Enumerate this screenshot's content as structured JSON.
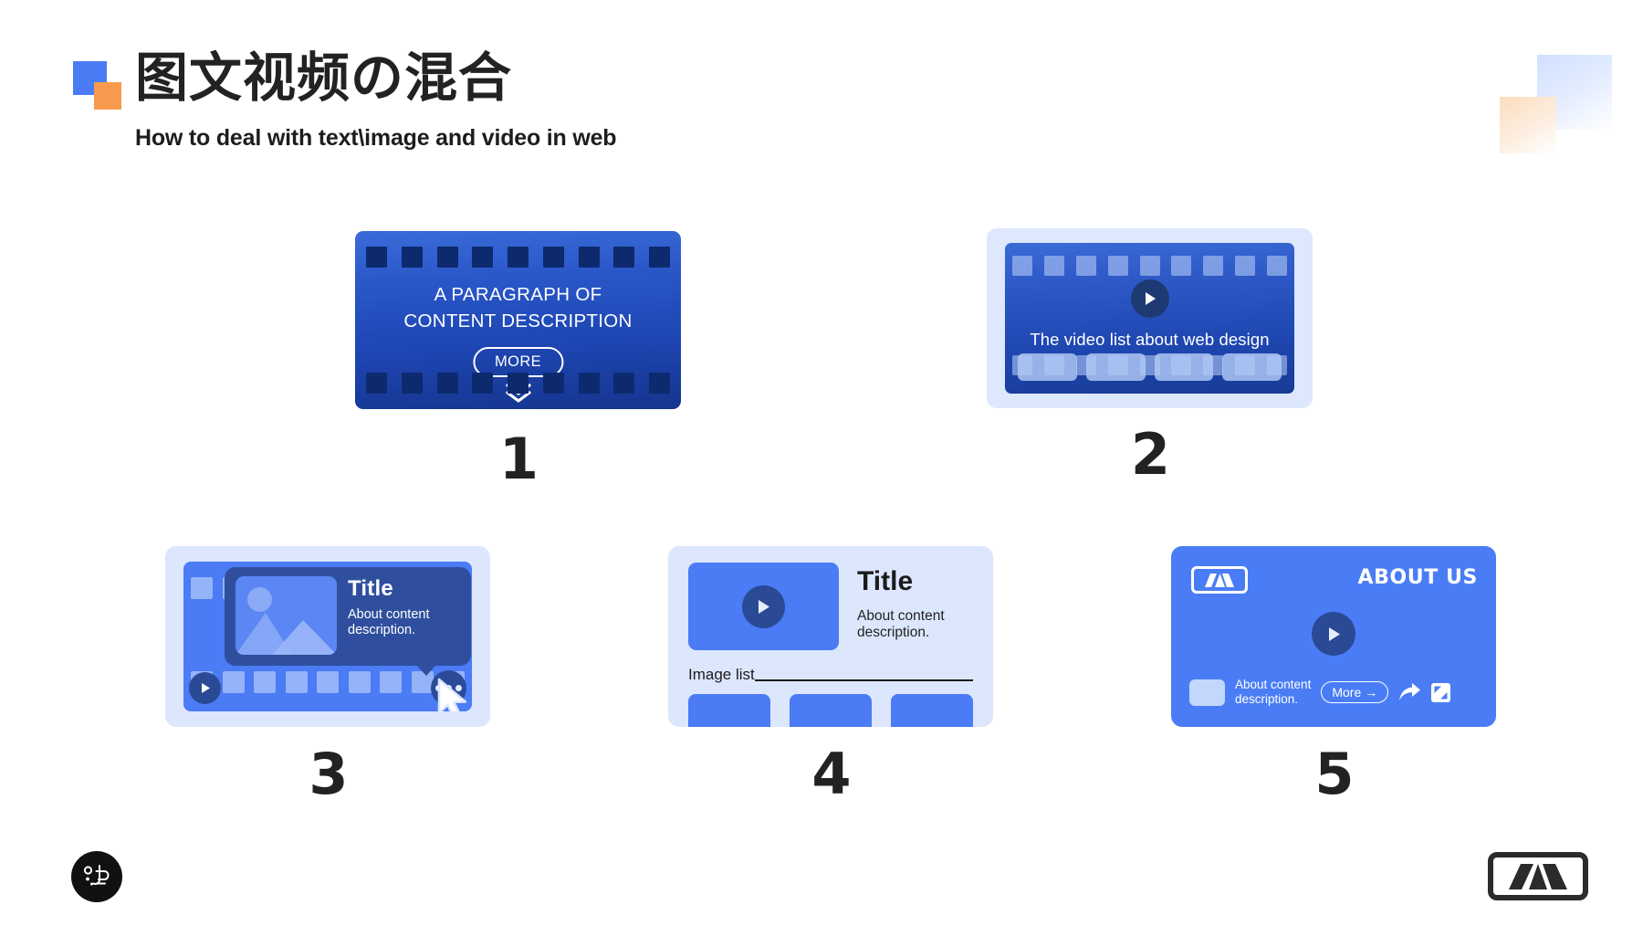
{
  "header": {
    "title": "図文視頻の混合",
    "title_cjk": "图文视频の混合",
    "subtitle": "How to deal with text\\image and video in web",
    "logo_icon": "two-squares-logo"
  },
  "colors": {
    "brand_blue": "#4A7DF5",
    "brand_orange": "#F89A4E",
    "card_light_blue": "#DCE7FD",
    "deep_blue_start": "#3A6BD8",
    "deep_blue_end": "#15358E",
    "dark_navy": "#0D2A6E",
    "text_dark": "#1B1B1B"
  },
  "cards": [
    {
      "number": "1",
      "name": "text-overlay-film-card",
      "body_line1": "A PARAGRAPH OF",
      "body_line2": "CONTENT DESCRIPTION",
      "more_label": "MORE",
      "scroll_icon": "double-chevron-down-icon",
      "perforations": 9
    },
    {
      "number": "2",
      "name": "video-list-film-card",
      "caption": "The video list about web design",
      "play_icon": "play-icon",
      "perforations": 9,
      "thumbnails": 4
    },
    {
      "number": "3",
      "name": "hover-tooltip-film-card",
      "tooltip_title": "Title",
      "tooltip_desc": "About content description.",
      "thumb_icon": "image-placeholder-icon",
      "play_icon": "play-icon",
      "menu_icon": "more-dots-icon",
      "cursor_icon": "cursor-arrow-icon",
      "perforations": 9
    },
    {
      "number": "4",
      "name": "video-with-image-list-card",
      "title": "Title",
      "desc": "About content description.",
      "list_label": "Image list",
      "play_icon": "play-icon",
      "chips": 3
    },
    {
      "number": "5",
      "name": "about-us-video-card",
      "brand_label": "ABOUT US",
      "logo_icon": "mountain-logo-icon",
      "play_icon": "play-icon",
      "footer_desc_line1": "About content",
      "footer_desc_line2": "description.",
      "more_label": "More",
      "more_arrow": "→",
      "share_icon": "share-arrow-icon",
      "expand_icon": "expand-fullscreen-icon"
    }
  ],
  "footer": {
    "left_logo_icon": "circular-brand-logo",
    "right_logo_icon": "mountain-logo-icon"
  }
}
